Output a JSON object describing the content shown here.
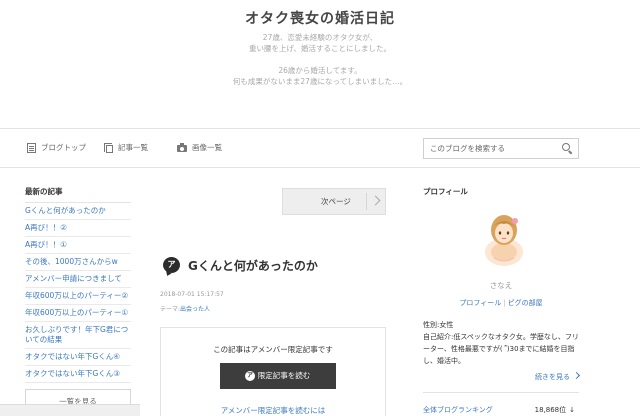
{
  "header": {
    "title": "オタク喪女の婚活日記",
    "description": [
      "27歳、恋愛未経験のオタク女が、",
      "重い腰を上げ、婚活することにしました。",
      "",
      "26歳から婚活してます。",
      "何も成果がないまま27歳になってしまいました…。"
    ]
  },
  "nav": {
    "items": [
      {
        "label": "ブログトップ",
        "icon": "document-icon"
      },
      {
        "label": "記事一覧",
        "icon": "copy-icon"
      },
      {
        "label": "画像一覧",
        "icon": "camera-icon"
      }
    ],
    "search_placeholder": "このブログを検索する"
  },
  "sidebar_left": {
    "heading": "最新の記事",
    "articles": [
      "Gくんと何があったのか",
      "A再び！！②",
      "A再び！！①",
      "その後、1000万さんからw",
      "アメンバー申請につきまして",
      "年収600万以上のパーティー②",
      "年収600万以上のパーティー①",
      "お久しぶりです！年下G君についての結果",
      "オタクではない年下Gくん④",
      "オタクではない年下Gくん③"
    ],
    "more_label": "一覧を見る"
  },
  "main": {
    "next_page_label": "次ページ",
    "entry": {
      "badge": "ア",
      "title": "Gくんと何があったのか",
      "date": "2018-07-01 15:17:57",
      "theme_label": "テーマ:",
      "theme_value": "出会った人"
    },
    "limited": {
      "message": "この記事はアメンバー限定記事です",
      "button_label": "限定記事を読む",
      "button_icon": "ア",
      "link": "アメンバー限定記事を読むには"
    }
  },
  "sidebar_right": {
    "heading": "プロフィール",
    "name": "さなえ",
    "link_profile": "プロフィール",
    "link_separator": "|",
    "link_room": "ピグの部屋",
    "bio": "性別:女性\n自己紹介:低スペックなオタク女。学歴なし、フリーター、性格最悪ですが(´゚)30までに結婚を目指し、婚活中。",
    "more_label": "続きを見る",
    "ranking_label": "全体ブログランキング",
    "ranking_value": "18,868位",
    "ranking_trend": "↓"
  },
  "colors": {
    "link": "#3a78c3",
    "button_dark": "#3d3d3d"
  }
}
